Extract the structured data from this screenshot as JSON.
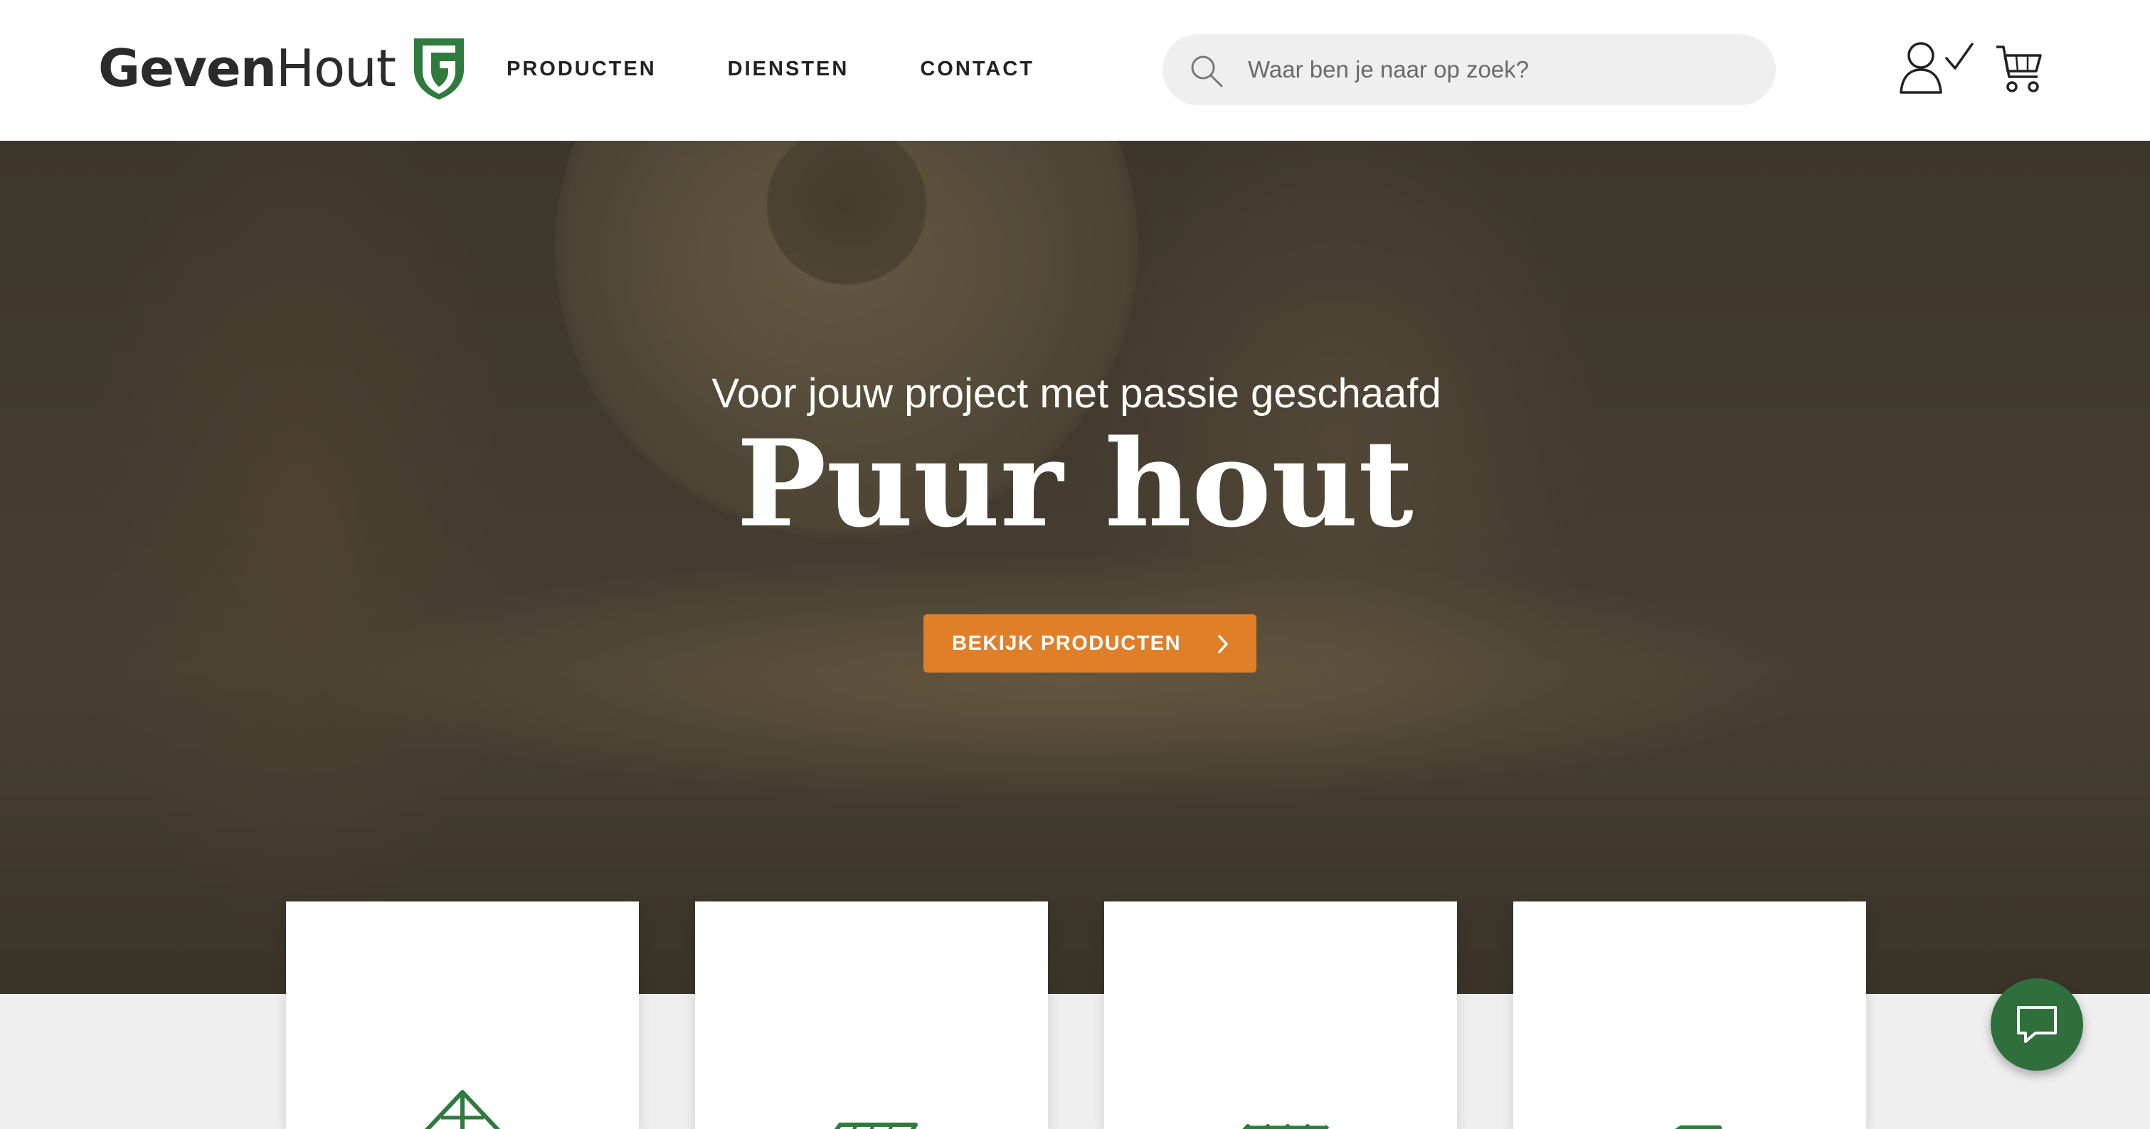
{
  "brand": {
    "name_bold": "Geven",
    "name_light": "Hout",
    "accent_green": "#2f7a3d",
    "accent_orange": "#e07f28"
  },
  "nav": {
    "items": [
      {
        "label": "PRODUCTEN"
      },
      {
        "label": "DIENSTEN"
      },
      {
        "label": "CONTACT"
      }
    ]
  },
  "search": {
    "placeholder": "Waar ben je naar op zoek?",
    "value": ""
  },
  "icons": {
    "search": "search-icon",
    "account": "account-check-icon",
    "cart": "shopping-cart-icon",
    "chat": "chat-bubble-icon",
    "chevron": "chevron-right-icon"
  },
  "hero": {
    "subtitle": "Voor jouw project met passie geschaafd",
    "title": "Puur hout",
    "cta_label": "BEKIJK PRODUCTEN"
  },
  "categories": [
    {
      "icon": "roof-beam-icon"
    },
    {
      "icon": "deck-planks-icon"
    },
    {
      "icon": "fence-icon"
    },
    {
      "icon": "stacked-boards-icon"
    }
  ]
}
